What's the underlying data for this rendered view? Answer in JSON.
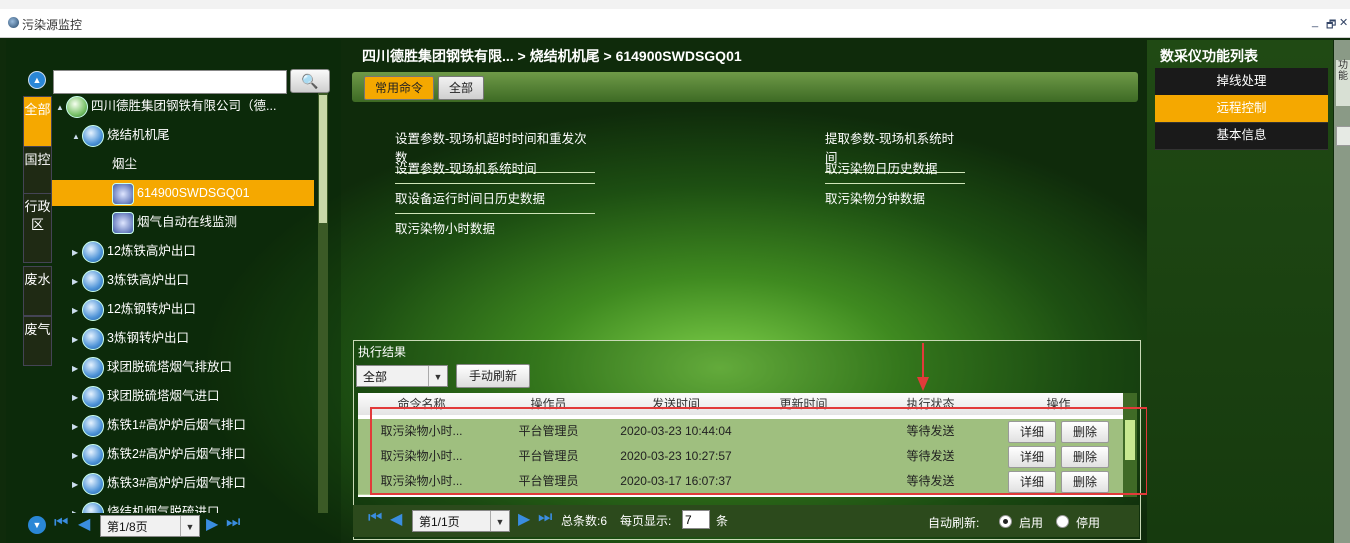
{
  "window": {
    "title": "污染源监控",
    "min_label": "_",
    "restore_label": "🗗",
    "close_label": "✕"
  },
  "left": {
    "search_placeholder": "",
    "search_button": "🔍",
    "collapse_icon": "▲",
    "vtabs": [
      {
        "label": "全部",
        "active": true
      },
      {
        "label": "国控",
        "active": false
      },
      {
        "label": "行政区",
        "active": false
      },
      {
        "label": "废水",
        "active": false
      },
      {
        "label": "废气",
        "active": false
      }
    ],
    "tree": [
      {
        "label": "四川德胜集团钢铁有限公司（德...",
        "level": 0,
        "icon": "house",
        "tri": "▲"
      },
      {
        "label": "烧结机机尾",
        "level": 1,
        "icon": "station",
        "tri": "▲"
      },
      {
        "label": "烟尘",
        "level": 2,
        "icon": "",
        "tri": ""
      },
      {
        "label": "614900SWDSGQ01",
        "level": 2,
        "icon": "device",
        "tri": "",
        "selected": true
      },
      {
        "label": "烟气自动在线监测",
        "level": 2,
        "icon": "device",
        "tri": ""
      },
      {
        "label": "12炼铁高炉出口",
        "level": 1,
        "icon": "station",
        "tri": "▶"
      },
      {
        "label": "3炼铁高炉出口",
        "level": 1,
        "icon": "station",
        "tri": "▶"
      },
      {
        "label": "12炼钢转炉出口",
        "level": 1,
        "icon": "station",
        "tri": "▶"
      },
      {
        "label": "3炼钢转炉出口",
        "level": 1,
        "icon": "station",
        "tri": "▶"
      },
      {
        "label": "球团脱硫塔烟气排放口",
        "level": 1,
        "icon": "station",
        "tri": "▶"
      },
      {
        "label": "球团脱硫塔烟气进口",
        "level": 1,
        "icon": "station",
        "tri": "▶"
      },
      {
        "label": "炼铁1#高炉炉后烟气排口",
        "level": 1,
        "icon": "station",
        "tri": "▶"
      },
      {
        "label": "炼铁2#高炉炉后烟气排口",
        "level": 1,
        "icon": "station",
        "tri": "▶"
      },
      {
        "label": "炼铁3#高炉炉后烟气排口",
        "level": 1,
        "icon": "station",
        "tri": "▶"
      },
      {
        "label": "烧结机烟气脱硫进口",
        "level": 1,
        "icon": "station",
        "tri": "▶"
      }
    ],
    "pager": {
      "page_label": "第1/8页"
    }
  },
  "main": {
    "breadcrumb": "四川德胜集团钢铁有限... > 烧结机机尾 > 614900SWDSGQ01",
    "tabs": [
      {
        "label": "常用命令",
        "active": true
      },
      {
        "label": "全部",
        "active": false
      }
    ],
    "commands_left": [
      "设置参数-现场机超时时间和重发次数",
      "设置参数-现场机系统时间",
      "取设备运行时间日历史数据",
      "取污染物小时数据"
    ],
    "commands_right": [
      "提取参数-现场机系统时间",
      "取污染物日历史数据",
      "取污染物分钟数据"
    ],
    "results": {
      "title": "执行结果",
      "filter_value": "全部",
      "refresh_button": "手动刷新",
      "columns": [
        "命令名称",
        "操作员",
        "发送时间",
        "更新时间",
        "执行状态",
        "操作"
      ],
      "rows": [
        {
          "name": "取污染物小时...",
          "operator": "平台管理员",
          "sent": "2020-03-23 10:44:04",
          "updated": "",
          "status": "等待发送"
        },
        {
          "name": "取污染物小时...",
          "operator": "平台管理员",
          "sent": "2020-03-23 10:27:57",
          "updated": "",
          "status": "等待发送"
        },
        {
          "name": "取污染物小时...",
          "operator": "平台管理员",
          "sent": "2020-03-17 16:07:37",
          "updated": "",
          "status": "等待发送"
        }
      ],
      "detail_label": "详细",
      "delete_label": "删除"
    },
    "pager": {
      "page_label": "第1/1页",
      "total_label": "总条数:6",
      "per_page_label": "每页显示:",
      "per_page_value": "7",
      "unit_label": "条",
      "auto_refresh_label": "自动刷新:",
      "enable_label": "启用",
      "disable_label": "停用"
    }
  },
  "right": {
    "title": "数采仪功能列表",
    "items": [
      {
        "label": "掉线处理",
        "active": false
      },
      {
        "label": "远程控制",
        "active": true
      },
      {
        "label": "基本信息",
        "active": false
      }
    ],
    "edge_label": "功能"
  },
  "colors": {
    "accent": "#f5a800",
    "highlight_box": "#e23a3a",
    "row_bg": "#9fbf7f"
  }
}
